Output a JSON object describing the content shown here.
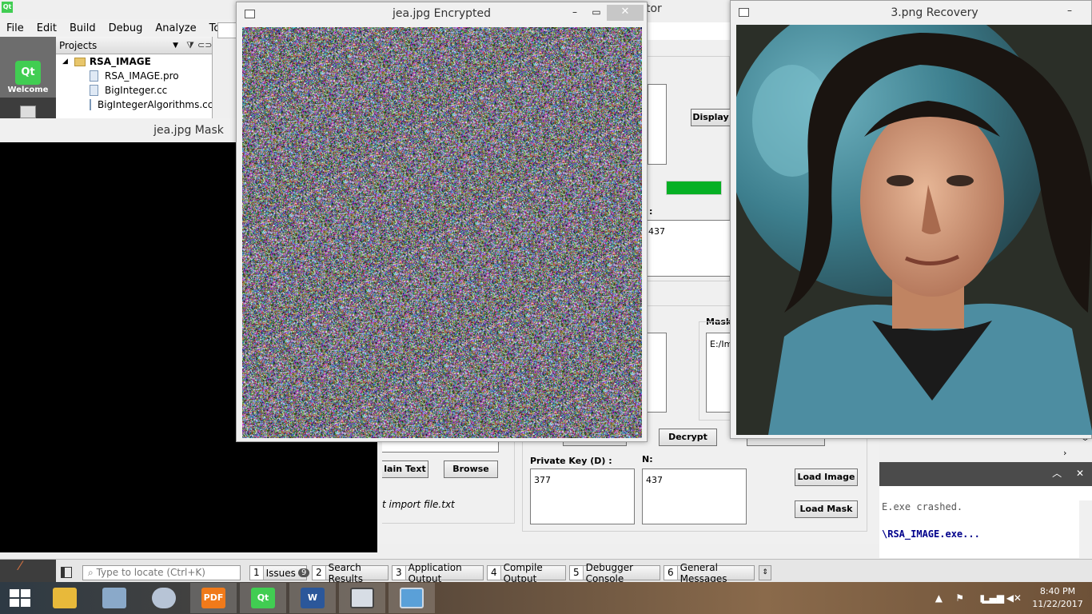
{
  "qt_creator": {
    "menu": [
      "File",
      "Edit",
      "Build",
      "Debug",
      "Analyze",
      "Tools"
    ],
    "welcome_label": "Welcome",
    "projects": {
      "header": "Projects",
      "root": "RSA_IMAGE",
      "files": [
        "RSA_IMAGE.pro",
        "BigInteger.cc",
        "BigIntegerAlgorithms.cc"
      ]
    },
    "window_title_fragment": "tor",
    "locate_placeholder": "Type to locate (Ctrl+K)",
    "output_tabs": [
      {
        "num": "1",
        "label": "Issues",
        "badge": "9"
      },
      {
        "num": "2",
        "label": "Search Results"
      },
      {
        "num": "3",
        "label": "Application Output"
      },
      {
        "num": "4",
        "label": "Compile Output"
      },
      {
        "num": "5",
        "label": "Debugger Console"
      },
      {
        "num": "6",
        "label": "General Messages"
      }
    ],
    "output_lines": [
      "E.exe crashed.",
      "",
      "\\RSA_IMAGE.exe..."
    ]
  },
  "rsa_app": {
    "display_button": "Display",
    "n_label_top": ":",
    "n_value_top": "437",
    "mask_label": "Mask",
    "mask_path": "E:/Im",
    "decrypt_button": "Decrypt",
    "plain_text_button": "lain Text",
    "browse_button": "Browse",
    "import_hint": "t import file.txt",
    "private_key_label": "Private Key (D) :",
    "private_key_value": "377",
    "n_label": "N:",
    "n_value": "437",
    "load_image_button": "Load Image",
    "load_mask_button": "Load Mask",
    "progress_fraction": 1.0,
    "progress_color": "#06b025"
  },
  "windows": {
    "mask_title": "jea.jpg Mask",
    "encrypted_title": "jea.jpg Encrypted",
    "recovery_title": "3.png Recovery"
  },
  "taskbar": {
    "time": "8:40 PM",
    "date": "11/22/2017",
    "apps": [
      "file-explorer",
      "performance-monitor",
      "paint",
      "pdf-reader",
      "qt-creator",
      "word",
      "image-viewer",
      "photos"
    ]
  }
}
